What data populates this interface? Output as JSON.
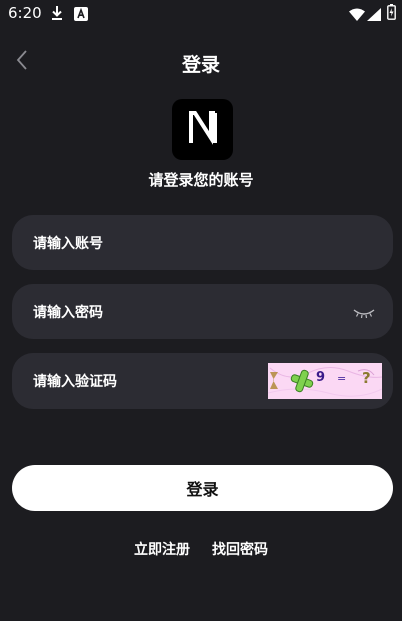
{
  "status_bar": {
    "time": "6:20",
    "icons": [
      "download-icon",
      "app-a-icon",
      "wifi-icon",
      "signal-icon",
      "battery-icon"
    ]
  },
  "header": {
    "title": "登录",
    "back_icon": "chevron-left-icon"
  },
  "logo": {
    "icon": "app-logo-n-icon"
  },
  "subtitle": "请登录您的账号",
  "form": {
    "account_placeholder": "请输入账号",
    "password_placeholder": "请输入密码",
    "password_toggle_icon": "eye-closed-icon",
    "captcha_placeholder": "请输入验证码",
    "captcha_image_text": [
      "9",
      "=",
      "?"
    ]
  },
  "login_button_label": "登录",
  "footer": {
    "register_label": "立即注册",
    "forgot_label": "找回密码"
  },
  "colors": {
    "background": "#1c1c20",
    "input_background": "#2c2c33",
    "button_background": "#ffffff",
    "captcha_background": "#fbd8f4"
  }
}
